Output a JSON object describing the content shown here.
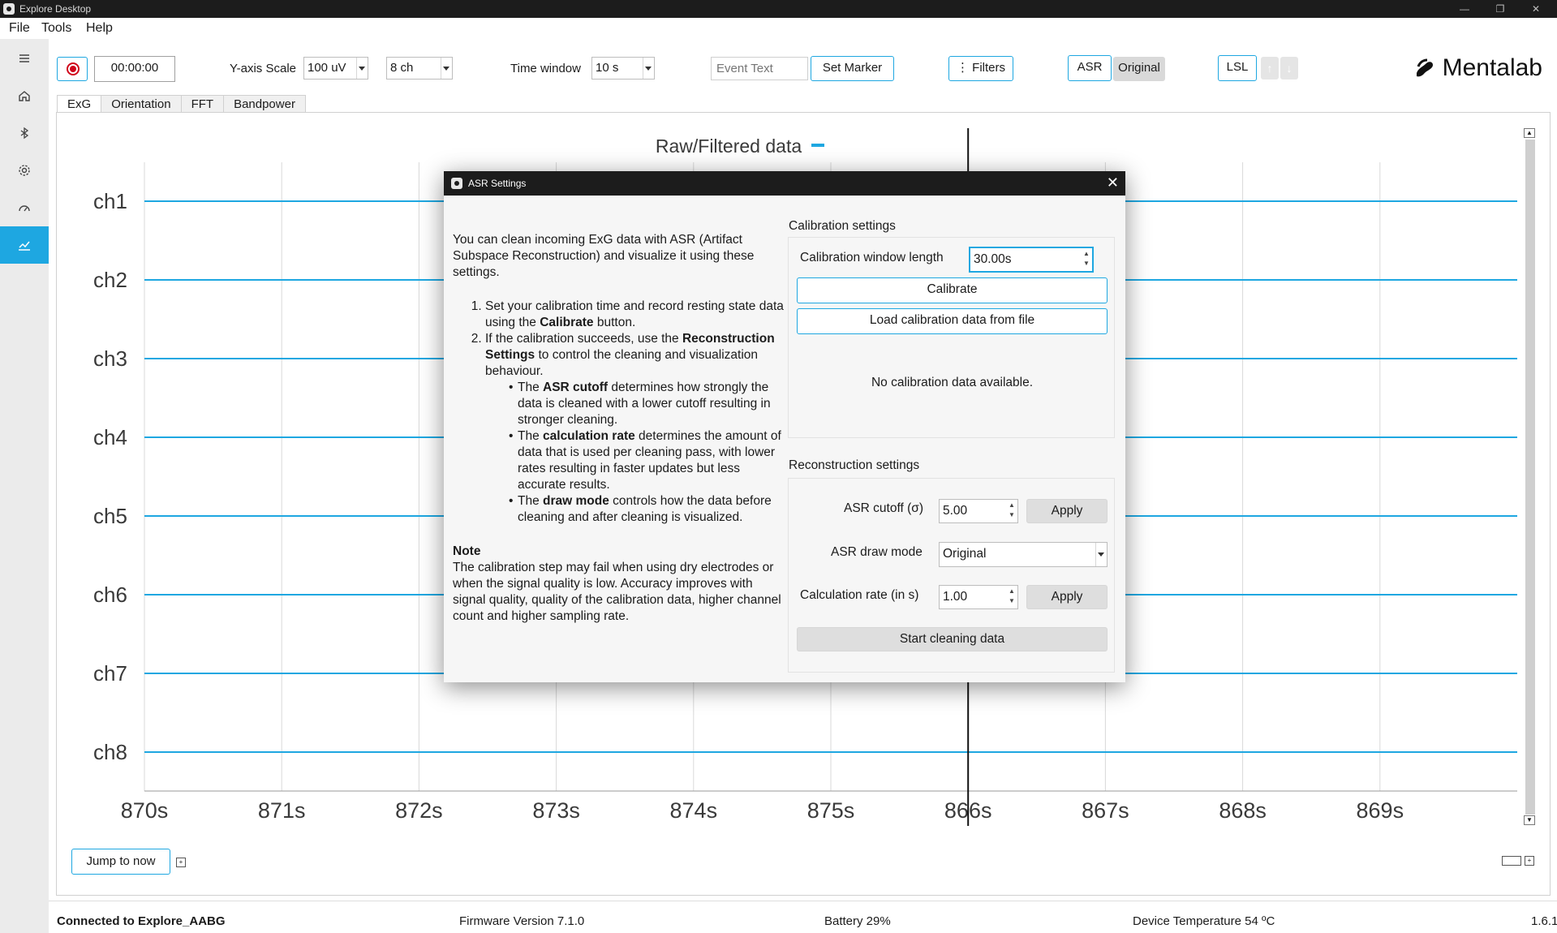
{
  "window": {
    "title": "Explore Desktop",
    "minimize": "—",
    "maximize": "❐",
    "close": "✕"
  },
  "menu": [
    "File",
    "Tools",
    "Help"
  ],
  "sidebar": {
    "items": [
      {
        "icon": "hamburger-menu-icon",
        "active": false
      },
      {
        "icon": "home-icon",
        "active": false
      },
      {
        "icon": "bluetooth-icon",
        "active": false
      },
      {
        "icon": "gear-icon",
        "active": false
      },
      {
        "icon": "gauge-icon",
        "active": false
      },
      {
        "icon": "chart-icon",
        "active": true
      }
    ]
  },
  "toolbar": {
    "timer": "00:00:00",
    "yscale_label": "Y-axis Scale",
    "yscale_value": "100 uV",
    "channels_value": "8 ch",
    "time_window_label": "Time window",
    "time_window_value": "10 s",
    "event_placeholder": "Event Text",
    "set_marker_label": "Set Marker",
    "filters_label": "⋮ Filters",
    "asr_label": "ASR",
    "original_label": "Original",
    "lsl_label": "LSL",
    "up_arrow": "↑",
    "down_arrow": "↓",
    "brand": "Mentalab",
    "accent_color": "#1ea7e1",
    "record_color": "#d0021b"
  },
  "tabs": [
    {
      "label": "ExG",
      "active": true
    },
    {
      "label": "Orientation",
      "active": false
    },
    {
      "label": "FFT",
      "active": false
    },
    {
      "label": "Bandpower",
      "active": false
    }
  ],
  "plot": {
    "title": "Raw/Filtered data",
    "legend_color": "#1ea7e1",
    "jump_label": "Jump to now",
    "scroll_up": "▲",
    "scroll_down": "▼",
    "ctl_plus": "+"
  },
  "chart_data": {
    "type": "line",
    "title": "Raw/Filtered data",
    "channels": [
      "ch1",
      "ch2",
      "ch3",
      "ch4",
      "ch5",
      "ch6",
      "ch7",
      "ch8"
    ],
    "x_ticks": [
      "870s",
      "871s",
      "872s",
      "873s",
      "874s",
      "875s",
      "866s",
      "867s",
      "868s",
      "869s"
    ],
    "cursor_tick": "866s",
    "series_color": "#1ea7e1",
    "grid": true
  },
  "status": {
    "connected": "Connected to Explore_AABG",
    "firmware": "Firmware Version  7.1.0",
    "battery": "Battery  29%",
    "temperature": "Device Temperature  54 ºC",
    "version": "1.6.1"
  },
  "dialog": {
    "title": "ASR Settings",
    "close": "✕",
    "intro": "You can clean incoming ExG data with ASR (Artifact Subspace Reconstruction) and visualize it using these settings.",
    "step1_pre": "Set your calibration time and record resting state data using the ",
    "step1_bold": "Calibrate",
    "step1_post": " button.",
    "step2_pre": "If the calibration succeeds, use the ",
    "step2_bold": "Reconstruction Settings",
    "step2_post": " to control the cleaning and visualization behaviour.",
    "bullet1_pre": "The ",
    "bullet1_bold": "ASR cutoff",
    "bullet1_post": " determines how strongly the data is cleaned with a lower cutoff resulting in stronger cleaning.",
    "bullet2_pre": "The ",
    "bullet2_bold": "calculation rate",
    "bullet2_post": " determines the amount of data that is used per cleaning pass, with lower rates resulting in faster updates but less accurate results.",
    "bullet3_pre": "The ",
    "bullet3_bold": "draw mode",
    "bullet3_post": " controls how the data before cleaning and after cleaning is visualized.",
    "note_head": "Note",
    "note_text": "The calibration step may fail when using dry electrodes or when the signal quality is low. Accuracy improves with signal quality, quality of the calibration data, higher channel count and higher sampling rate.",
    "calibration_settings": "Calibration settings",
    "calib_window_label": "Calibration window length",
    "calib_window_value": "30.00s",
    "calibrate_label": "Calibrate",
    "load_label": "Load calibration data from file",
    "no_calib": "No calibration data available.",
    "reconstruction_settings": "Reconstruction settings",
    "cutoff_label": "ASR cutoff (σ)",
    "cutoff_value": "5.00",
    "apply_label": "Apply",
    "draw_mode_label": "ASR draw mode",
    "draw_mode_value": "Original",
    "rate_label": "Calculation rate (in s)",
    "rate_value": "1.00",
    "start_label": "Start cleaning data",
    "spin_up": "▲",
    "spin_down": "▼"
  }
}
